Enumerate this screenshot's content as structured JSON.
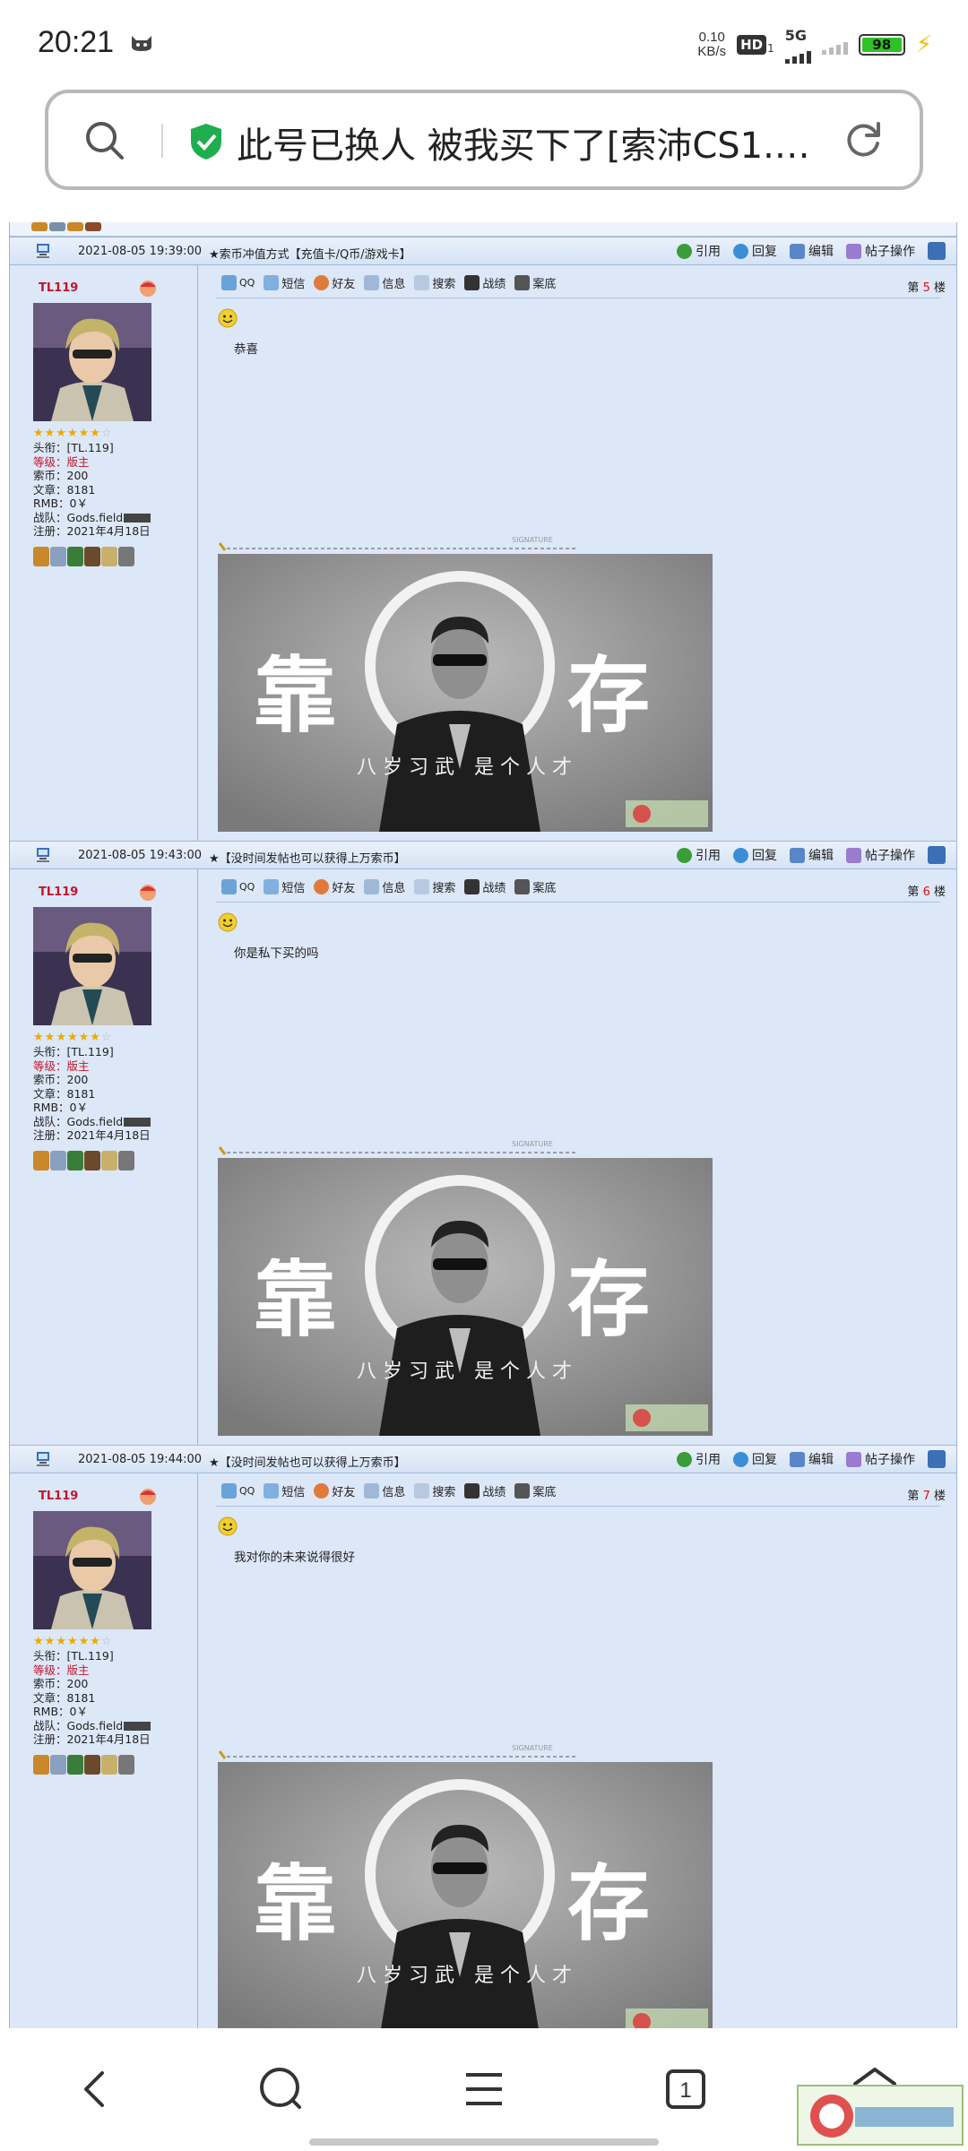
{
  "status": {
    "time": "20:21",
    "net_speed_value": "0.10",
    "net_speed_unit": "KB/s",
    "hd": "HD",
    "hd_sub": "1",
    "network": "5G",
    "battery": "98"
  },
  "url": {
    "text": "此号已换人 被我买下了[索沛CS1.…"
  },
  "posts": [
    {
      "date": "2021-08-05 19:39:00",
      "title": "★索币冲值方式【充值卡/Q币/游戏卡】",
      "floor_prefix": "第",
      "floor": "5",
      "floor_suffix": "楼",
      "content": "恭喜"
    },
    {
      "date": "2021-08-05 19:43:00",
      "title": "★【没时间发帖也可以获得上万索币】",
      "floor_prefix": "第",
      "floor": "6",
      "floor_suffix": "楼",
      "content": "你是私下买的吗"
    },
    {
      "date": "2021-08-05 19:44:00",
      "title": "★【没时间发帖也可以获得上万索币】",
      "floor_prefix": "第",
      "floor": "7",
      "floor_suffix": "楼",
      "content": "我对你的未来说得很好"
    }
  ],
  "actions": {
    "quote": "引用",
    "reply": "回复",
    "edit": "编辑",
    "post_ops": "帖子操作"
  },
  "toolbar": {
    "qq": "QQ",
    "sms": "短信",
    "friend": "好友",
    "info": "信息",
    "search": "搜索",
    "record": "战绩",
    "bottom": "案底"
  },
  "user": {
    "name": "TL119",
    "title_label": "头衔：",
    "title_value": "[TL.119]",
    "level_label": "等级：",
    "level_value": "版主",
    "coin_label": "索币：",
    "coin_value": "200",
    "articles_label": "文章：",
    "articles_value": "8181",
    "rmb_label": "RMB：",
    "rmb_value": "0￥",
    "team_label": "战队：",
    "team_value": "Gods.field",
    "reg_label": "注册：",
    "reg_value": "2021年4月18日",
    "stars_filled": 6,
    "stars_total": 7
  },
  "signature": {
    "label": "SIGNATURE",
    "big_left": "靠",
    "big_right": "存",
    "caption": "八 岁 习 武　是 个 人 才"
  },
  "colors": {
    "forum_bg": "#dce7f7",
    "header_border": "#9fb7da",
    "username": "#c0162d",
    "floor_number": "#dd1111",
    "shield": "#1fae4f",
    "battery": "#2fc227"
  }
}
